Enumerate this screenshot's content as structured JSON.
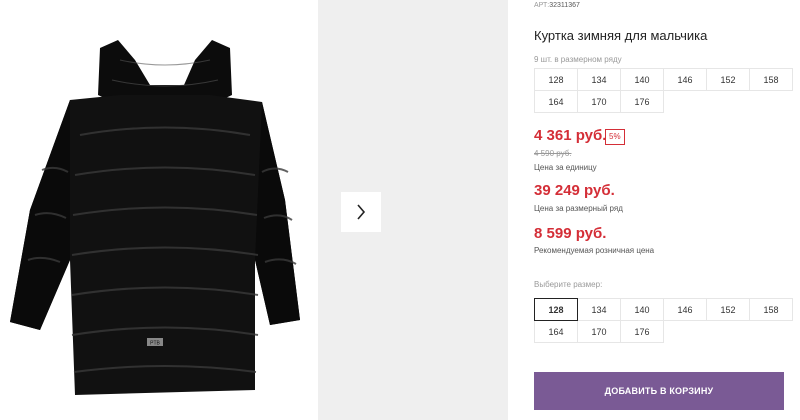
{
  "product": {
    "article_label": "АРТ:",
    "article_number": "32311367",
    "title": "Куртка зимняя для мальчика",
    "sizes_note": "9 шт. в размерном ряду",
    "size_range": [
      "128",
      "134",
      "140",
      "146",
      "152",
      "158",
      "164",
      "170",
      "176"
    ],
    "image_logo": "PTB"
  },
  "pricing": {
    "price": "4 361 руб.",
    "discount": "5%",
    "old_price": "4 590 руб.",
    "price_caption": "Цена за единицу",
    "row_price": "39 249 руб.",
    "row_caption": "Цена за размерный ряд",
    "rrp_price": "8 599 руб.",
    "rrp_caption": "Рекомендуемая розничная цена"
  },
  "size_select": {
    "label": "Выберите размер:",
    "options": [
      "128",
      "134",
      "140",
      "146",
      "152",
      "158",
      "164",
      "170",
      "176"
    ],
    "selected": "128"
  },
  "actions": {
    "add_to_cart": "ДОБАВИТЬ В КОРЗИНУ"
  },
  "colors": {
    "price_red": "#d42e37",
    "button_purple": "#7a5a95",
    "gallery_bg": "#efefef"
  },
  "icons": {
    "next": "chevron-right-icon"
  }
}
